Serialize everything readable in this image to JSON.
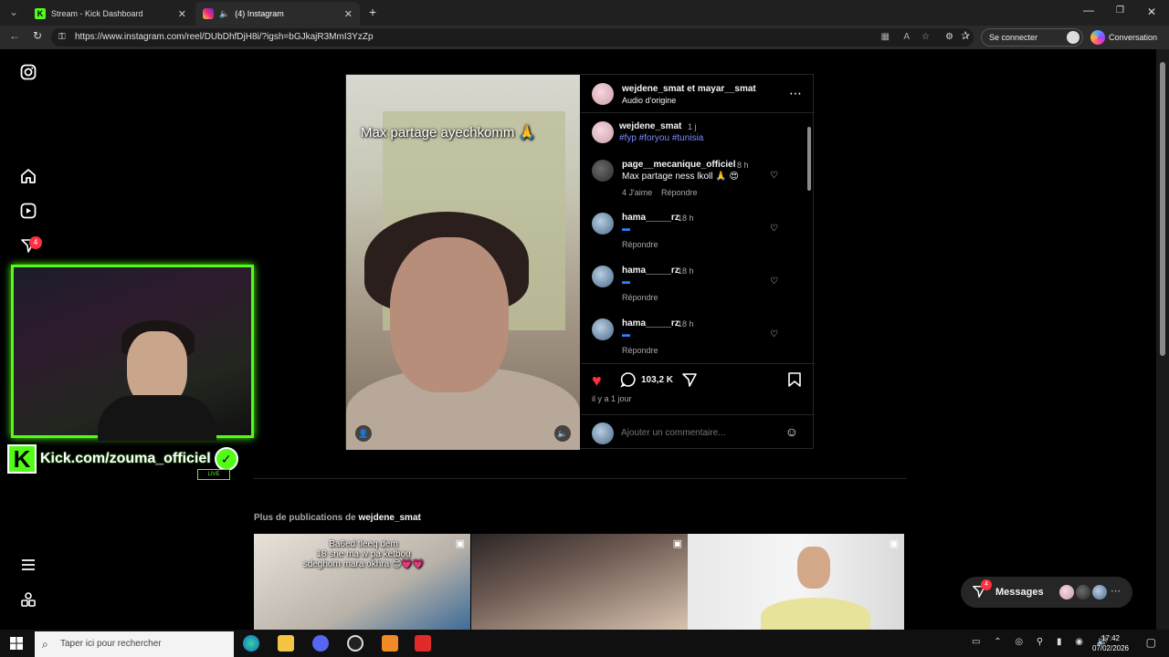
{
  "browser": {
    "tabs": [
      {
        "title": "Stream - Kick Dashboard",
        "icon": "kick-icon"
      },
      {
        "title": "(4) Instagram",
        "icon": "instagram-icon"
      }
    ],
    "url": "https://www.instagram.com/reel/DUbDhfDjH8i/?igsh=bGJkajR3MmI3YzZp",
    "sign_in": "Se connecter",
    "conversation": "Conversation"
  },
  "sidebar": {
    "notifications_badge": "4"
  },
  "stream_overlay": {
    "url_text": "Kick.com/zouma_officiel",
    "live": "LIVE",
    "k": "K"
  },
  "reel": {
    "caption": "Max partage ayechkomm 🙏",
    "header": {
      "users": "wejdene_smat et mayar__smat",
      "audio": "Audio d'origine"
    },
    "post": {
      "user": "wejdene_smat",
      "time": "1 j",
      "tags": "#fyp #foryou #tunisia"
    },
    "comments": [
      {
        "user": "page__mecanique_officiel",
        "time": "8 h",
        "text": "Max partage ness lkoll 🙏 😍",
        "likes": "4 J'aime",
        "reply": "Répondre"
      },
      {
        "user": "hama_____rz",
        "time": "18 h",
        "text": "▬",
        "reply": "Répondre"
      },
      {
        "user": "hama_____rz",
        "time": "18 h",
        "text": "▬",
        "reply": "Répondre"
      },
      {
        "user": "hama_____rz",
        "time": "18 h",
        "text": "▬",
        "reply": "Répondre"
      }
    ],
    "likes_count": "103,2 K",
    "date": "il y a 1 jour",
    "add_comment_placeholder": "Ajouter un commentaire..."
  },
  "more_posts": {
    "prefix": "Plus de publications de",
    "user": "wejdene_smat",
    "thumbs": [
      {
        "caption": "Ba6ed tleeq dem\n18 sne ma w pa ketbou\nsdeghom mara okhra 😊💗💗"
      },
      {
        "caption": ""
      },
      {
        "caption": ""
      }
    ]
  },
  "messages": {
    "label": "Messages",
    "badge": "4"
  },
  "taskbar": {
    "search_placeholder": "Taper ici pour rechercher",
    "time": "17:42",
    "date": "07/02/2026"
  },
  "colors": {
    "kick_green": "#53fc18",
    "ig_link": "#7c8bff",
    "like_red": "#ff3040"
  }
}
